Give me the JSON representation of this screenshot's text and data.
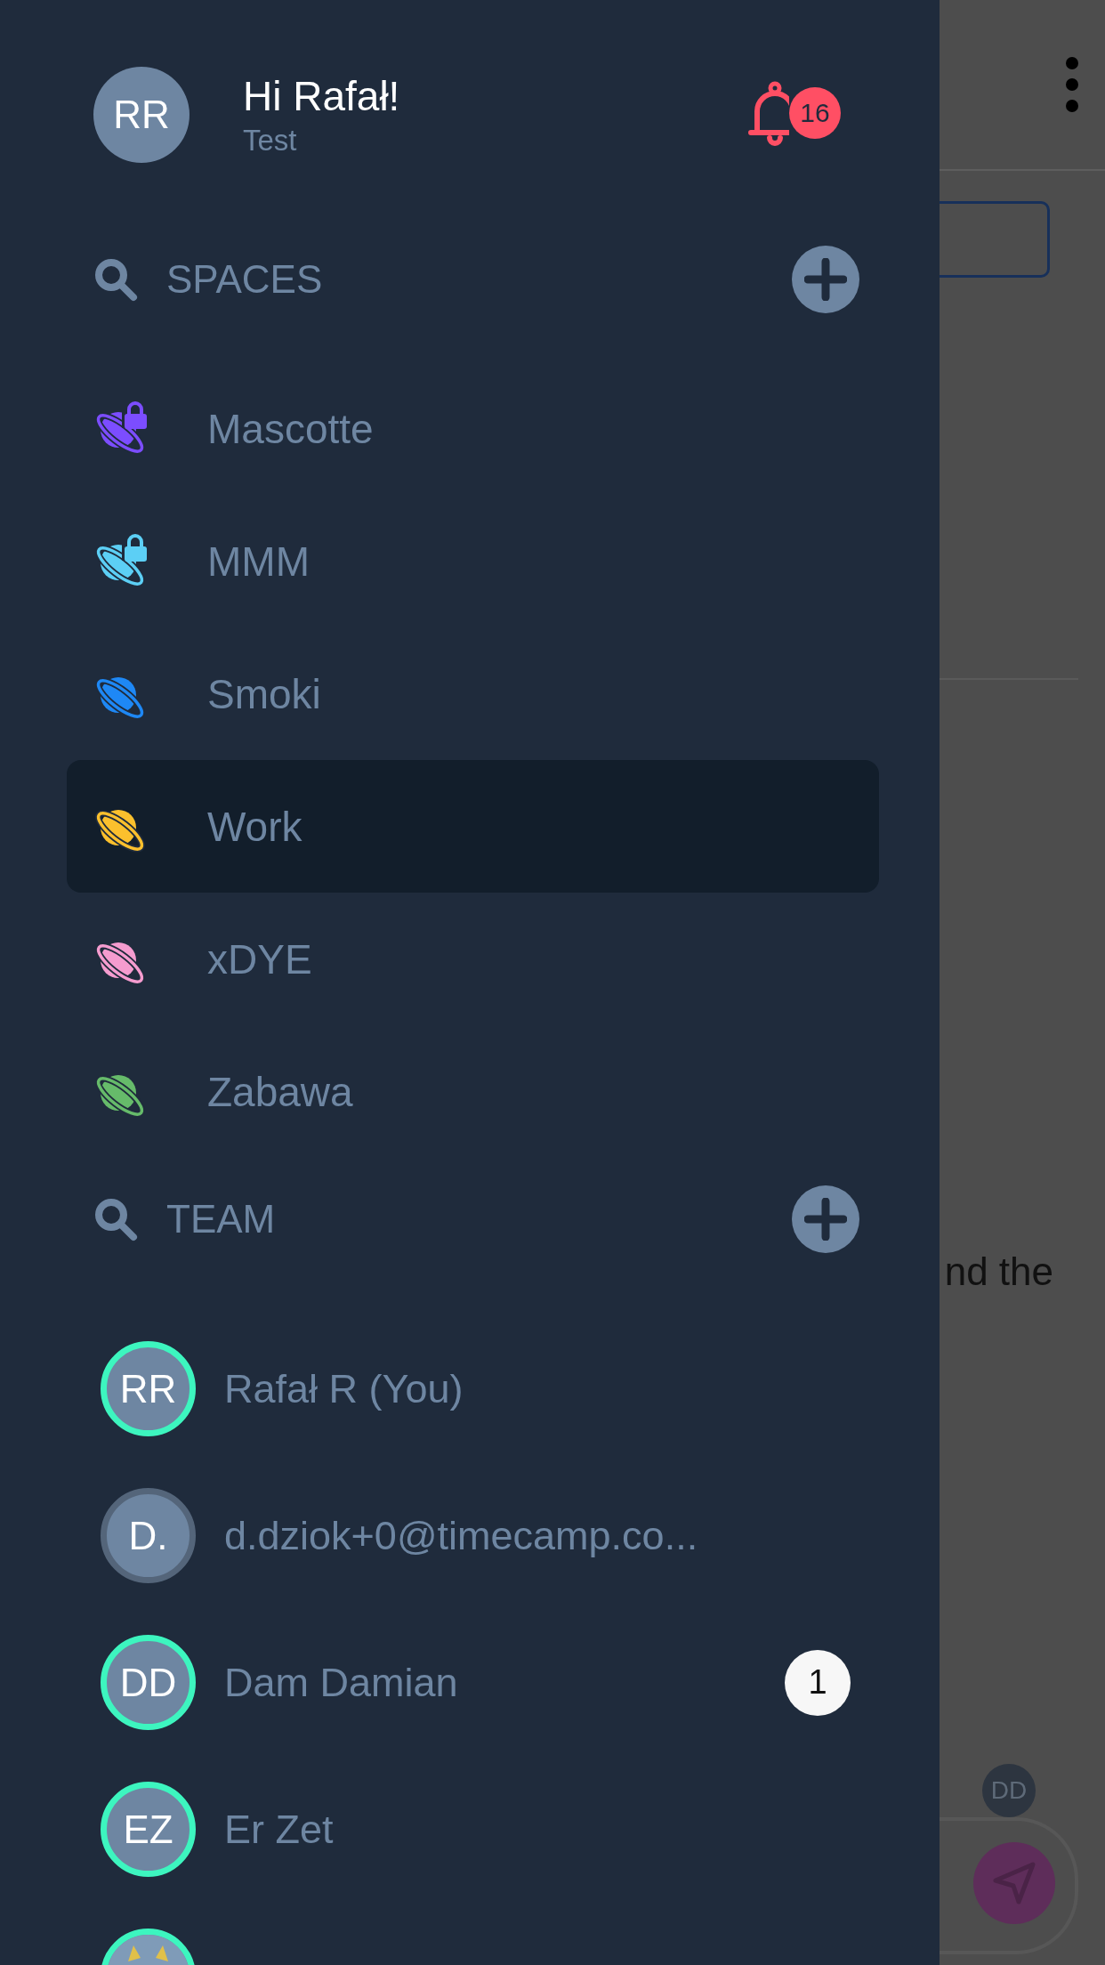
{
  "drawer": {
    "user": {
      "initials": "RR",
      "greeting": "Hi Rafał!",
      "subtitle": "Test",
      "notifications": "16"
    },
    "spaces_header": {
      "label": "SPACES"
    },
    "spaces": [
      {
        "name": "Mascotte",
        "kind": "locked",
        "color": "#7c4dff",
        "selected": false
      },
      {
        "name": "MMM",
        "kind": "locked",
        "color": "#5ccff5",
        "selected": false
      },
      {
        "name": "Smoki",
        "kind": "public",
        "color": "#1e88f5",
        "selected": false
      },
      {
        "name": "Work",
        "kind": "public",
        "color": "#fbc02d",
        "selected": true
      },
      {
        "name": "xDYE",
        "kind": "public",
        "color": "#f59ccf",
        "selected": false
      },
      {
        "name": "Zabawa",
        "kind": "public",
        "color": "#66bb6a",
        "selected": false
      }
    ],
    "team_header": {
      "label": "TEAM"
    },
    "team": [
      {
        "initials": "RR",
        "name": "Rafał R (You)",
        "online": true
      },
      {
        "initials": "D.",
        "name": "d.dziok+0@timecamp.co...",
        "online": false
      },
      {
        "initials": "DD",
        "name": "Dam Damian",
        "online": true,
        "unread": "1"
      },
      {
        "initials": "EZ",
        "name": "Er Zet",
        "online": true
      },
      {
        "kind": "picture",
        "online": true
      }
    ]
  },
  "background": {
    "message_fragment": "nd the",
    "avatar": "DD"
  }
}
